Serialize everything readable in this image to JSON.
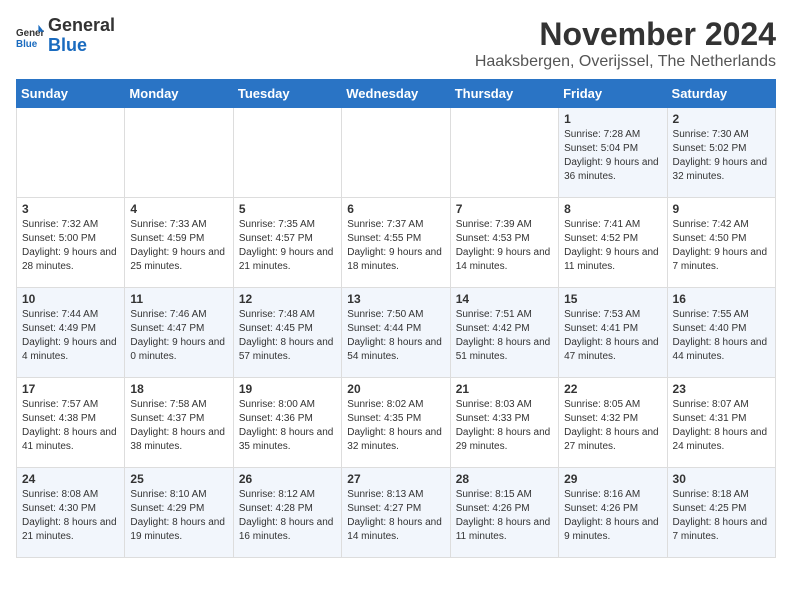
{
  "logo": {
    "general": "General",
    "blue": "Blue"
  },
  "title": "November 2024",
  "subtitle": "Haaksbergen, Overijssel, The Netherlands",
  "header_days": [
    "Sunday",
    "Monday",
    "Tuesday",
    "Wednesday",
    "Thursday",
    "Friday",
    "Saturday"
  ],
  "weeks": [
    [
      {
        "day": "",
        "content": ""
      },
      {
        "day": "",
        "content": ""
      },
      {
        "day": "",
        "content": ""
      },
      {
        "day": "",
        "content": ""
      },
      {
        "day": "",
        "content": ""
      },
      {
        "day": "1",
        "content": "Sunrise: 7:28 AM\nSunset: 5:04 PM\nDaylight: 9 hours and 36 minutes."
      },
      {
        "day": "2",
        "content": "Sunrise: 7:30 AM\nSunset: 5:02 PM\nDaylight: 9 hours and 32 minutes."
      }
    ],
    [
      {
        "day": "3",
        "content": "Sunrise: 7:32 AM\nSunset: 5:00 PM\nDaylight: 9 hours and 28 minutes."
      },
      {
        "day": "4",
        "content": "Sunrise: 7:33 AM\nSunset: 4:59 PM\nDaylight: 9 hours and 25 minutes."
      },
      {
        "day": "5",
        "content": "Sunrise: 7:35 AM\nSunset: 4:57 PM\nDaylight: 9 hours and 21 minutes."
      },
      {
        "day": "6",
        "content": "Sunrise: 7:37 AM\nSunset: 4:55 PM\nDaylight: 9 hours and 18 minutes."
      },
      {
        "day": "7",
        "content": "Sunrise: 7:39 AM\nSunset: 4:53 PM\nDaylight: 9 hours and 14 minutes."
      },
      {
        "day": "8",
        "content": "Sunrise: 7:41 AM\nSunset: 4:52 PM\nDaylight: 9 hours and 11 minutes."
      },
      {
        "day": "9",
        "content": "Sunrise: 7:42 AM\nSunset: 4:50 PM\nDaylight: 9 hours and 7 minutes."
      }
    ],
    [
      {
        "day": "10",
        "content": "Sunrise: 7:44 AM\nSunset: 4:49 PM\nDaylight: 9 hours and 4 minutes."
      },
      {
        "day": "11",
        "content": "Sunrise: 7:46 AM\nSunset: 4:47 PM\nDaylight: 9 hours and 0 minutes."
      },
      {
        "day": "12",
        "content": "Sunrise: 7:48 AM\nSunset: 4:45 PM\nDaylight: 8 hours and 57 minutes."
      },
      {
        "day": "13",
        "content": "Sunrise: 7:50 AM\nSunset: 4:44 PM\nDaylight: 8 hours and 54 minutes."
      },
      {
        "day": "14",
        "content": "Sunrise: 7:51 AM\nSunset: 4:42 PM\nDaylight: 8 hours and 51 minutes."
      },
      {
        "day": "15",
        "content": "Sunrise: 7:53 AM\nSunset: 4:41 PM\nDaylight: 8 hours and 47 minutes."
      },
      {
        "day": "16",
        "content": "Sunrise: 7:55 AM\nSunset: 4:40 PM\nDaylight: 8 hours and 44 minutes."
      }
    ],
    [
      {
        "day": "17",
        "content": "Sunrise: 7:57 AM\nSunset: 4:38 PM\nDaylight: 8 hours and 41 minutes."
      },
      {
        "day": "18",
        "content": "Sunrise: 7:58 AM\nSunset: 4:37 PM\nDaylight: 8 hours and 38 minutes."
      },
      {
        "day": "19",
        "content": "Sunrise: 8:00 AM\nSunset: 4:36 PM\nDaylight: 8 hours and 35 minutes."
      },
      {
        "day": "20",
        "content": "Sunrise: 8:02 AM\nSunset: 4:35 PM\nDaylight: 8 hours and 32 minutes."
      },
      {
        "day": "21",
        "content": "Sunrise: 8:03 AM\nSunset: 4:33 PM\nDaylight: 8 hours and 29 minutes."
      },
      {
        "day": "22",
        "content": "Sunrise: 8:05 AM\nSunset: 4:32 PM\nDaylight: 8 hours and 27 minutes."
      },
      {
        "day": "23",
        "content": "Sunrise: 8:07 AM\nSunset: 4:31 PM\nDaylight: 8 hours and 24 minutes."
      }
    ],
    [
      {
        "day": "24",
        "content": "Sunrise: 8:08 AM\nSunset: 4:30 PM\nDaylight: 8 hours and 21 minutes."
      },
      {
        "day": "25",
        "content": "Sunrise: 8:10 AM\nSunset: 4:29 PM\nDaylight: 8 hours and 19 minutes."
      },
      {
        "day": "26",
        "content": "Sunrise: 8:12 AM\nSunset: 4:28 PM\nDaylight: 8 hours and 16 minutes."
      },
      {
        "day": "27",
        "content": "Sunrise: 8:13 AM\nSunset: 4:27 PM\nDaylight: 8 hours and 14 minutes."
      },
      {
        "day": "28",
        "content": "Sunrise: 8:15 AM\nSunset: 4:26 PM\nDaylight: 8 hours and 11 minutes."
      },
      {
        "day": "29",
        "content": "Sunrise: 8:16 AM\nSunset: 4:26 PM\nDaylight: 8 hours and 9 minutes."
      },
      {
        "day": "30",
        "content": "Sunrise: 8:18 AM\nSunset: 4:25 PM\nDaylight: 8 hours and 7 minutes."
      }
    ]
  ]
}
